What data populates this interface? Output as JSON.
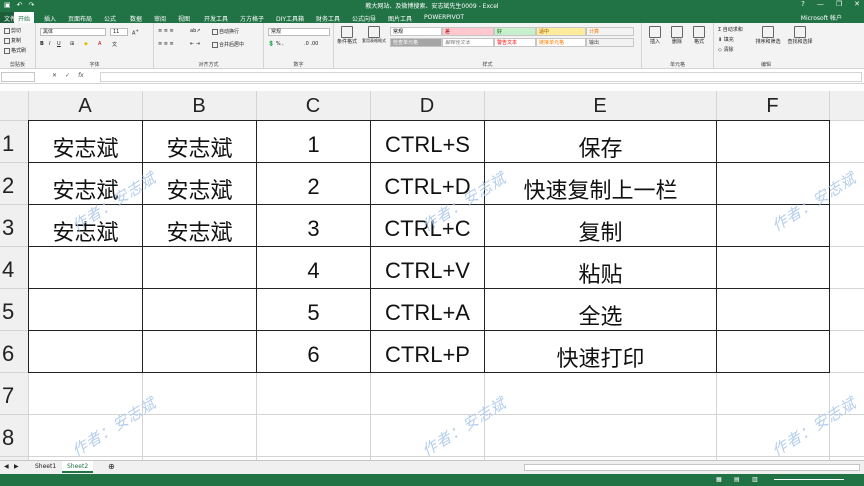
{
  "window": {
    "title": "教大网站、及微博搜索、安志斌先生0009 - Excel",
    "account": "Microsoft 帐户"
  },
  "tabs": [
    "文件",
    "开始",
    "插入",
    "页面布局",
    "公式",
    "数据",
    "审阅",
    "视图",
    "开发工具",
    "方方格子",
    "DIY工具箱",
    "财务工具",
    "公式向导",
    "图片工具",
    "POWERPIVOT"
  ],
  "ribbon": {
    "clipboard": {
      "cut": "剪切",
      "copy": "复制",
      "painter": "格式刷",
      "group": "剪贴板"
    },
    "font": {
      "name": "黑体",
      "size": "11",
      "group": "字体"
    },
    "align": {
      "wrap": "自动换行",
      "merge": "合并后居中",
      "group": "对齐方式"
    },
    "number": {
      "format": "常规",
      "group": "数字"
    },
    "styles": {
      "cond": "条件格式",
      "table": "套用表格格式",
      "items": [
        "常规",
        "差",
        "好",
        "适中",
        "计算",
        "检查单元格",
        "解释性文本",
        "警告文本",
        "链接单元格",
        "输出"
      ],
      "group": "样式"
    },
    "cells": {
      "insert": "插入",
      "delete": "删除",
      "format": "格式",
      "group": "单元格"
    },
    "editing": {
      "autosum": "自动求和",
      "fill": "填充",
      "clear": "清除",
      "sort": "排序和筛选",
      "find": "查找和选择",
      "group": "编辑"
    }
  },
  "formula_bar": {
    "cancel": "✕",
    "enter": "✓",
    "fx": "fx"
  },
  "columns": [
    "A",
    "B",
    "C",
    "D",
    "E",
    "F"
  ],
  "rows": [
    "1",
    "2",
    "3",
    "4",
    "5",
    "6",
    "7",
    "8"
  ],
  "cells": [
    [
      "安志斌",
      "安志斌",
      "1",
      "CTRL+S",
      "保存",
      ""
    ],
    [
      "安志斌",
      "安志斌",
      "2",
      "CTRL+D",
      "快速复制上一栏",
      ""
    ],
    [
      "安志斌",
      "安志斌",
      "3",
      "CTRL+C",
      "复制",
      ""
    ],
    [
      "",
      "",
      "4",
      "CTRL+V",
      "粘贴",
      ""
    ],
    [
      "",
      "",
      "5",
      "CTRL+A",
      "全选",
      ""
    ],
    [
      "",
      "",
      "6",
      "CTRL+P",
      "快速打印",
      ""
    ]
  ],
  "watermark": "作者：安志斌",
  "sheets": [
    "Sheet1",
    "Sheet2"
  ],
  "active_sheet": "Sheet2",
  "colors": {
    "excel_green": "#217346",
    "watermark": "#a9c6e8"
  }
}
